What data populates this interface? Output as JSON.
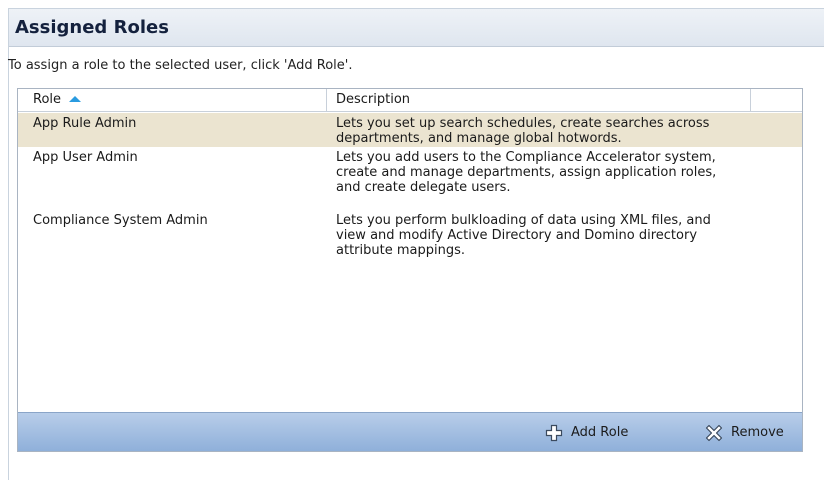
{
  "panel": {
    "title": "Assigned Roles",
    "instruction": "To assign a role to the selected user, click 'Add Role'."
  },
  "grid": {
    "columns": [
      {
        "label": "Role",
        "sort": "ascending"
      },
      {
        "label": "Description"
      }
    ],
    "rows": [
      {
        "role": "App Rule Admin",
        "description": "Lets you set up search schedules, create searches across departments, and manage global hotwords.",
        "selected": true
      },
      {
        "role": "App User Admin",
        "description": "Lets you add users to the Compliance Accelerator system, create and manage departments, assign application roles, and create delegate users.",
        "selected": false
      },
      {
        "role": "Compliance System Admin",
        "description": "Lets you perform bulkloading of data using XML files, and view and modify Active Directory and Domino directory attribute mappings.",
        "selected": false
      }
    ]
  },
  "footer": {
    "add_label": "Add Role",
    "add_icon": "plus-icon",
    "remove_label": "Remove",
    "remove_icon": "remove-x-icon"
  },
  "colors": {
    "header_bg": "#e4eaf2",
    "selected_row": "#ebe4d0",
    "footer_bar": "#a8c1e3",
    "sort_arrow": "#2a9be0"
  }
}
